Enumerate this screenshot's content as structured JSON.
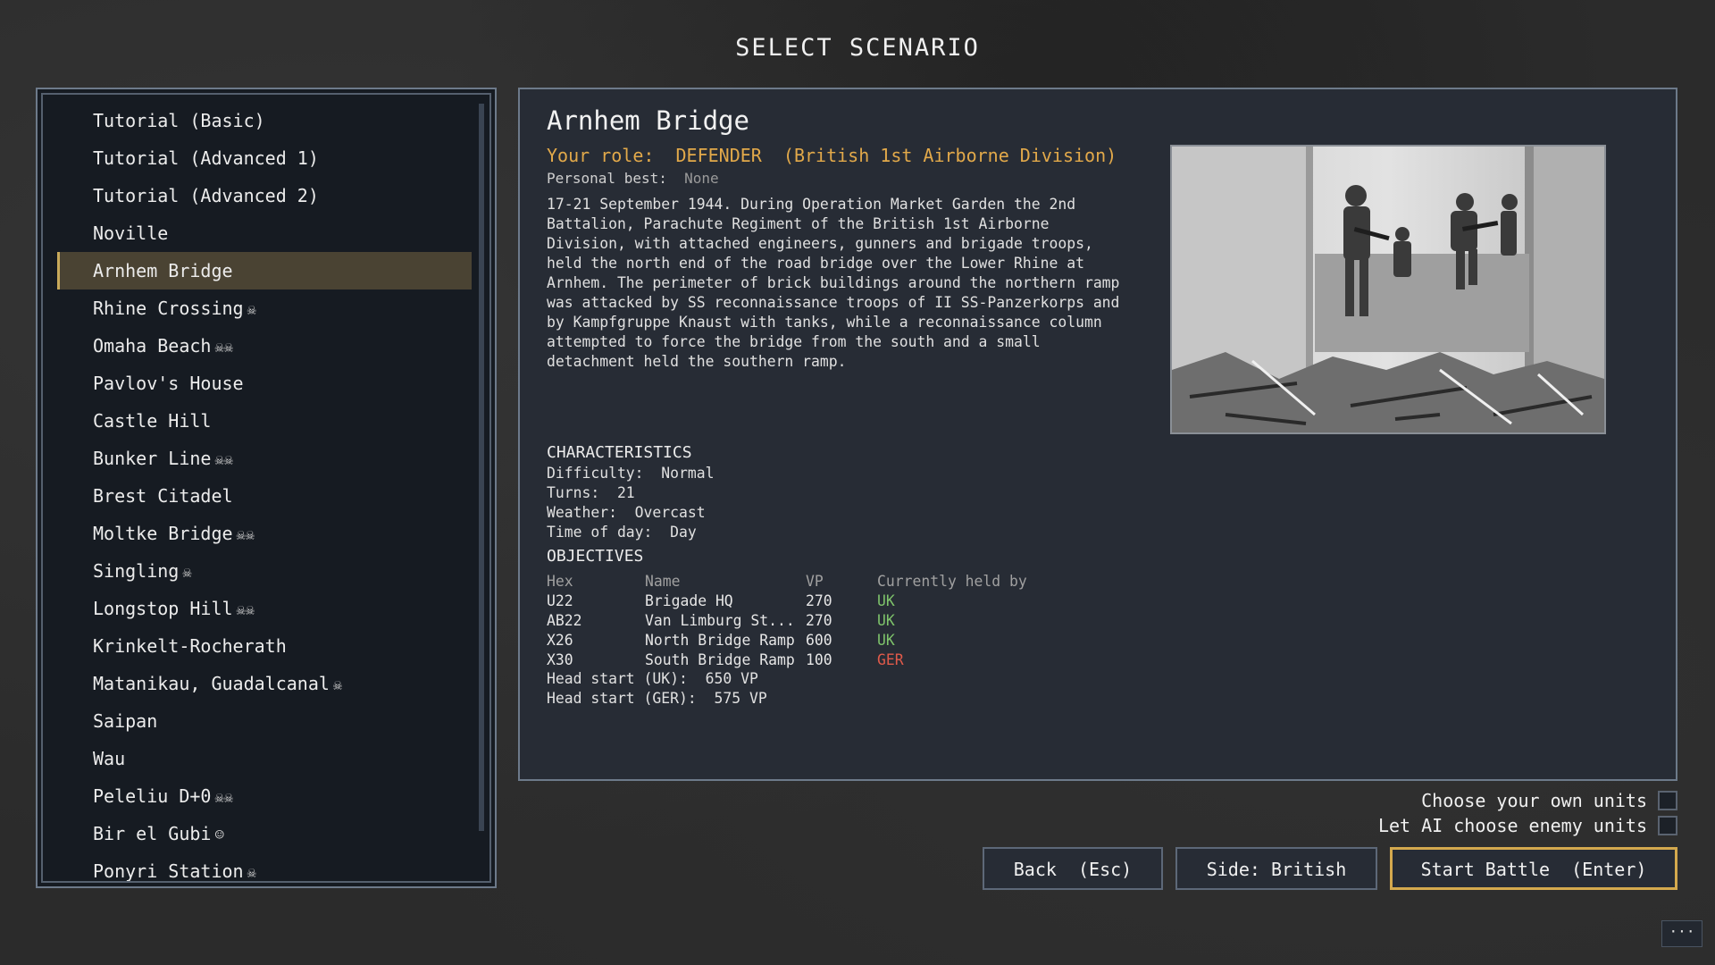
{
  "screen_title": "SELECT SCENARIO",
  "scenarios": [
    {
      "label": "Tutorial (Basic)",
      "marks": ""
    },
    {
      "label": "Tutorial (Advanced 1)",
      "marks": ""
    },
    {
      "label": "Tutorial (Advanced 2)",
      "marks": ""
    },
    {
      "label": "Noville",
      "marks": ""
    },
    {
      "label": "Arnhem Bridge",
      "marks": ""
    },
    {
      "label": "Rhine Crossing",
      "marks": "☠"
    },
    {
      "label": "Omaha Beach",
      "marks": "☠☠"
    },
    {
      "label": "Pavlov's House",
      "marks": ""
    },
    {
      "label": "Castle Hill",
      "marks": ""
    },
    {
      "label": "Bunker Line",
      "marks": "☠☠"
    },
    {
      "label": "Brest Citadel",
      "marks": ""
    },
    {
      "label": "Moltke Bridge",
      "marks": "☠☠"
    },
    {
      "label": "Singling",
      "marks": "☠"
    },
    {
      "label": "Longstop Hill",
      "marks": "☠☠"
    },
    {
      "label": "Krinkelt-Rocherath",
      "marks": ""
    },
    {
      "label": "Matanikau, Guadalcanal",
      "marks": "☠"
    },
    {
      "label": "Saipan",
      "marks": ""
    },
    {
      "label": "Wau",
      "marks": ""
    },
    {
      "label": "Peleliu D+0",
      "marks": "☠☠"
    },
    {
      "label": "Bir el Gubi",
      "marks": "☺"
    },
    {
      "label": "Ponyri Station",
      "marks": "☠"
    }
  ],
  "selected_index": 4,
  "detail": {
    "title": "Arnhem Bridge",
    "role_label": "Your role:  DEFENDER  (British 1st Airborne Division)",
    "best_label": "Personal best:",
    "best_value": "None",
    "description": "17-21 September 1944. During Operation Market Garden the 2nd Battalion, Parachute Regiment of the British 1st Airborne Division, with attached engineers, gunners and brigade troops, held the north end of the road bridge over the Lower Rhine at Arnhem. The perimeter of brick buildings around the northern ramp was attacked by SS reconnaissance troops of II SS-Panzerkorps and by Kampfgruppe Knaust with tanks, while a reconnaissance column attempted to force the bridge from the south and a small detachment held the southern ramp.",
    "characteristics_heading": "CHARACTERISTICS",
    "difficulty": "Difficulty:  Normal",
    "turns": "Turns:  21",
    "weather": "Weather:  Overcast",
    "time_of_day": "Time of day:  Day",
    "objectives_heading": "OBJECTIVES",
    "objectives_columns": [
      "Hex",
      "Name",
      "VP",
      "Currently held by"
    ],
    "objectives": [
      {
        "hex": "U22",
        "name": "Brigade HQ",
        "vp": "270",
        "held": "UK"
      },
      {
        "hex": "AB22",
        "name": "Van Limburg St...",
        "vp": "270",
        "held": "UK"
      },
      {
        "hex": "X26",
        "name": "North Bridge Ramp",
        "vp": "600",
        "held": "UK"
      },
      {
        "hex": "X30",
        "name": "South Bridge Ramp",
        "vp": "100",
        "held": "GER"
      }
    ],
    "head_start_uk": "Head start (UK):  650 VP",
    "head_start_ger": "Head start (GER):  575 VP"
  },
  "options": {
    "own_units": "Choose your own units",
    "ai_enemy": "Let AI choose enemy units"
  },
  "buttons": {
    "back": "Back  (Esc)",
    "side": "Side: British",
    "start": "Start Battle  (Enter)"
  },
  "more_label": "···",
  "colors": {
    "accent": "#d4a94e",
    "role": "#e2a94a",
    "uk": "#7ec36b",
    "ger": "#e05a4a",
    "selected_bg": "#4a4333"
  }
}
